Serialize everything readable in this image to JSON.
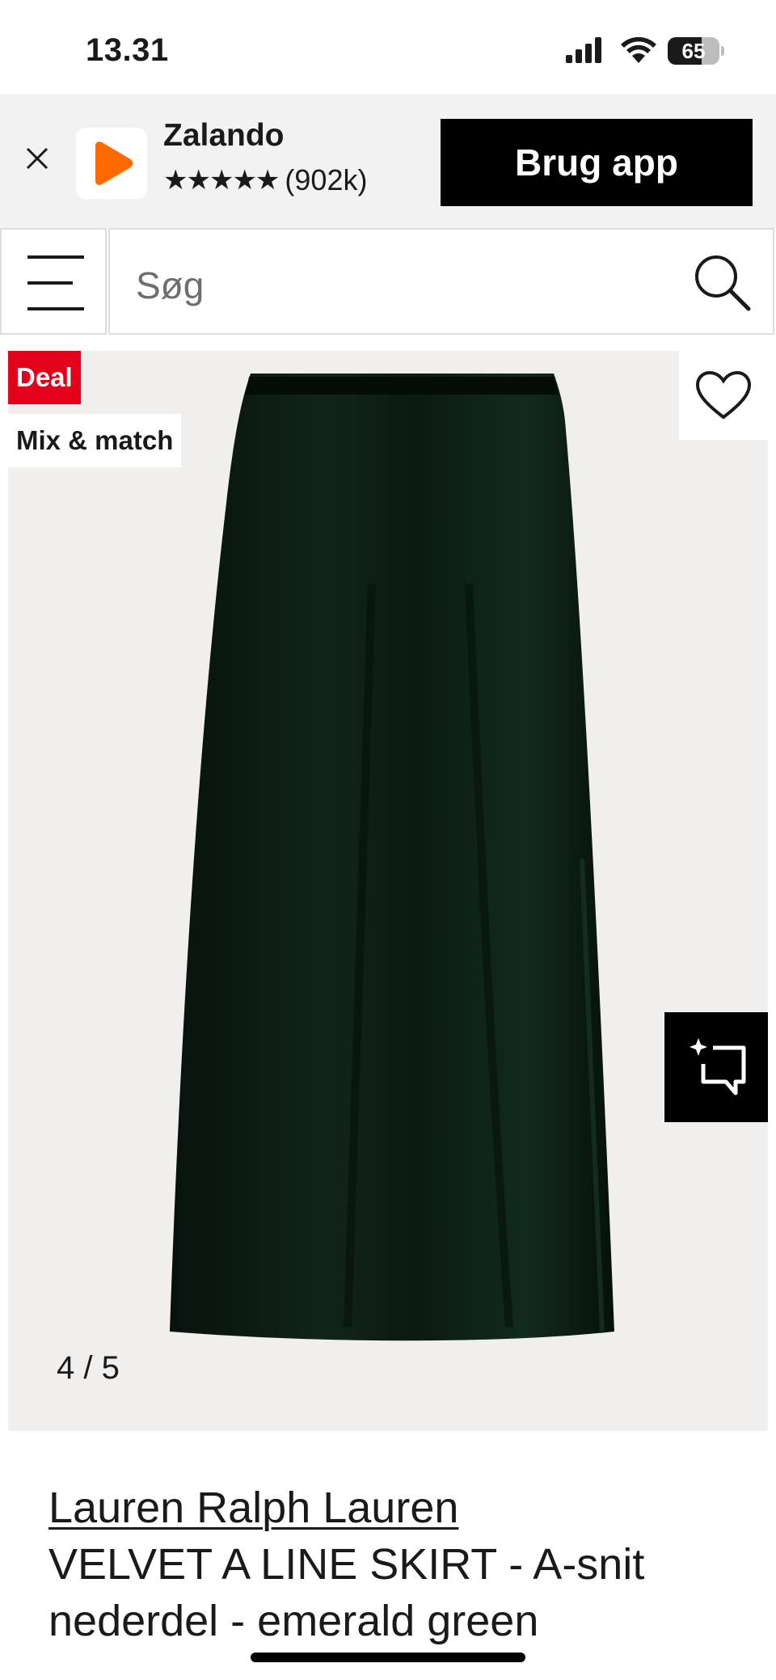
{
  "status_bar": {
    "time": "13.31",
    "battery_level": "65",
    "battery_fraction": 0.65
  },
  "app_banner": {
    "app_name": "Zalando",
    "stars": "★★★★★",
    "rating_count": "(902k)",
    "use_app_label": "Brug app",
    "brand_color": "#ff6900"
  },
  "search": {
    "placeholder": "Søg"
  },
  "gallery": {
    "badges": {
      "deal": "Deal",
      "mix_match": "Mix & match"
    },
    "image_position": "4 / 5",
    "product_color": "#0d1e17"
  },
  "product": {
    "brand": "Lauren Ralph Lauren",
    "title": "VELVET A LINE SKIRT - A-snit nederdel - emerald green"
  },
  "colors": {
    "deal_red": "#e2001a",
    "gallery_bg": "#f0efee"
  }
}
